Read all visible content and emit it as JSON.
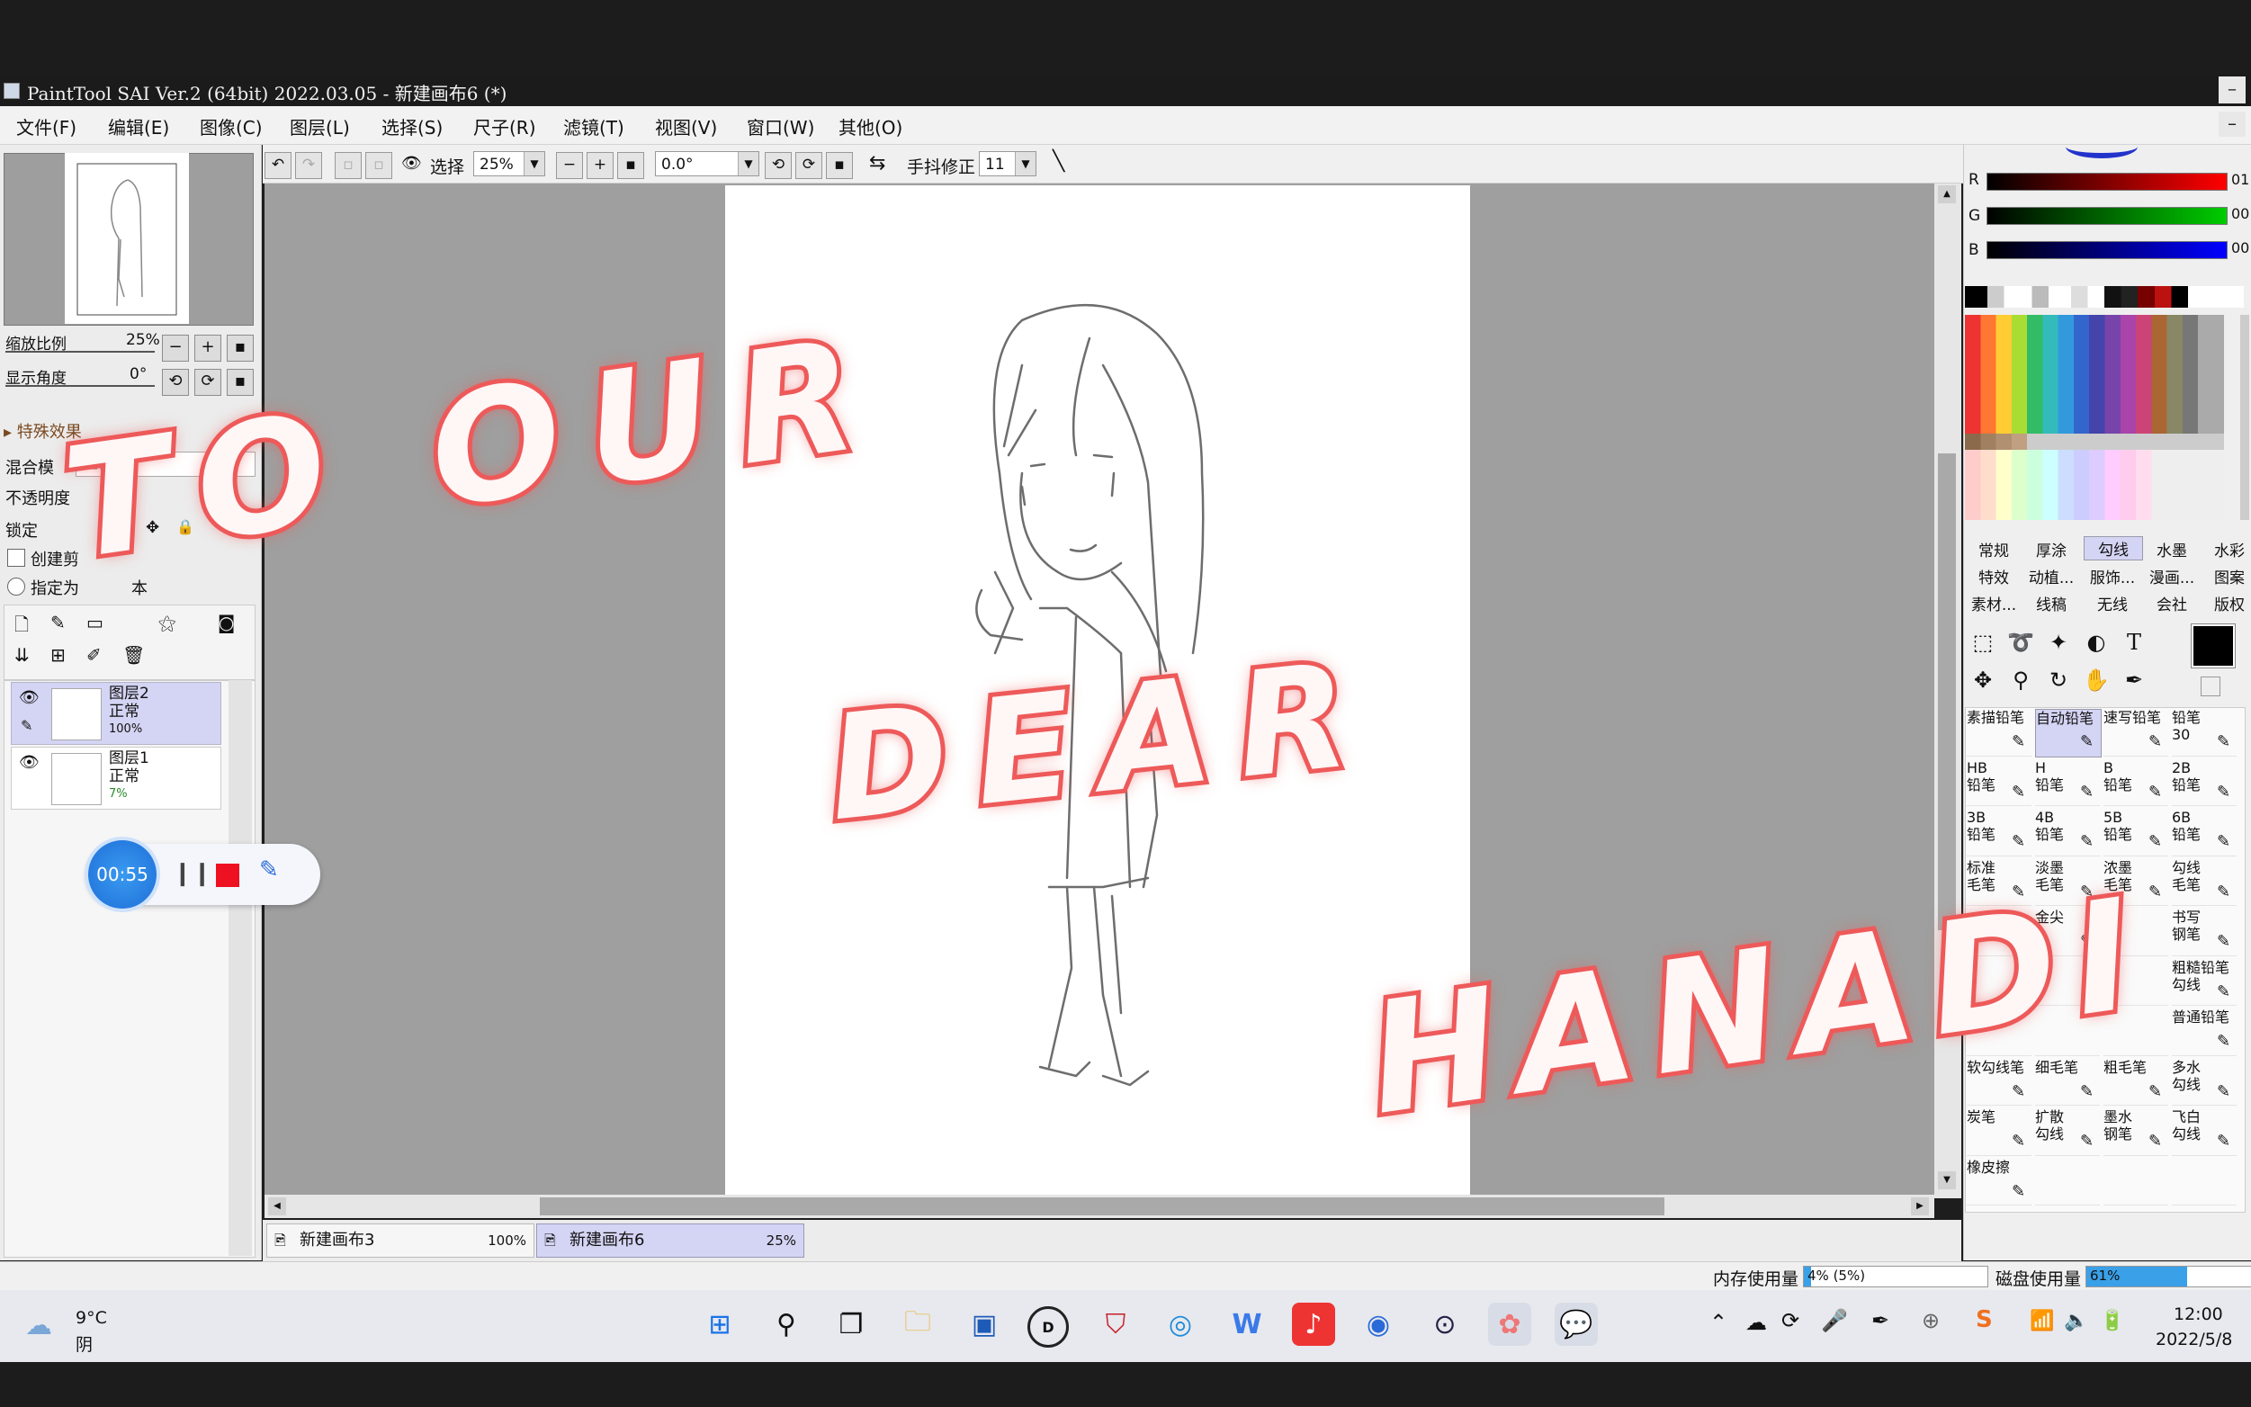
{
  "window": {
    "title": "PaintTool SAI Ver.2 (64bit) 2022.03.05 - 新建画布6 (*)"
  },
  "menu": [
    "文件(F)",
    "编辑(E)",
    "图像(C)",
    "图层(L)",
    "选择(S)",
    "尺子(R)",
    "滤镜(T)",
    "视图(V)",
    "窗口(W)",
    "其他(O)"
  ],
  "navigator": {
    "zoom_label": "缩放比例",
    "zoom_value": "25%",
    "angle_label": "显示角度",
    "angle_value": "0°"
  },
  "layer_props": {
    "effects": "特殊效果",
    "blend": "混合模",
    "blend_value": "正常",
    "opacity": "不透明度",
    "opacity_value": "1",
    "lock": "锁定",
    "clip": "创建剪",
    "designate": "指定为",
    "designate_suffix": "本"
  },
  "layers": [
    {
      "name": "图层2",
      "mode": "正常",
      "opacity": "100%"
    },
    {
      "name": "图层1",
      "mode": "正常",
      "opacity": "7%"
    }
  ],
  "recorder": {
    "time": "00:55"
  },
  "toolbar": {
    "select_label": "选择",
    "zoom": "25%",
    "angle": "0.0°",
    "stabilizer_label": "手抖修正",
    "stabilizer_value": "11"
  },
  "doc_tabs": [
    {
      "name": "新建画布3",
      "zoom": "100%"
    },
    {
      "name": "新建画布6",
      "zoom": "25%"
    }
  ],
  "rgb": [
    {
      "label": "R",
      "value": "01"
    },
    {
      "label": "G",
      "value": "00"
    },
    {
      "label": "B",
      "value": "00"
    }
  ],
  "brush_tabs": [
    [
      "常规",
      "厚涂",
      "勾线",
      "水墨",
      "水彩"
    ],
    [
      "特效",
      "动植...",
      "服饰...",
      "漫画...",
      "图案"
    ],
    [
      "素材...",
      "线稿",
      "无线",
      "会社",
      "版权"
    ]
  ],
  "brush_tools": [
    [
      "素描铅笔",
      "自动铅笔",
      "速写铅笔",
      "铅笔\n30"
    ],
    [
      "HB\n铅笔",
      "H\n铅笔",
      "B\n铅笔",
      "2B\n铅笔"
    ],
    [
      "3B\n铅笔",
      "4B\n铅笔",
      "5B\n铅笔",
      "6B\n铅笔"
    ],
    [
      "标准\n毛笔",
      "淡墨\n毛笔",
      "浓墨\n毛笔",
      "勾线\n毛笔"
    ],
    [
      "",
      "金尖",
      "",
      "书写\n钢笔"
    ],
    [
      "",
      "",
      "",
      "粗糙铅笔\n勾线"
    ],
    [
      "",
      "",
      "",
      "普通铅笔"
    ],
    [
      "软勾线笔",
      "细毛笔",
      "粗毛笔",
      "多水\n勾线"
    ],
    [
      "炭笔",
      "扩散\n勾线",
      "墨水\n钢笔",
      "飞白\n勾线"
    ],
    [
      "橡皮擦",
      "",
      "",
      ""
    ]
  ],
  "status": {
    "mem_label": "内存使用量",
    "mem_value": "4% (5%)",
    "disk_label": "磁盘使用量",
    "disk_value": "61%"
  },
  "taskbar": {
    "weather_temp": "9°C",
    "weather_desc": "阴",
    "time": "12:00",
    "date": "2022/5/8"
  },
  "overlay": {
    "line1": "TO OUR",
    "line2": "DEAR",
    "line3": "HANADI"
  },
  "colors": {
    "accent": "#ee5a5a",
    "selection": "#d4d4f4",
    "canvas_bg": "#9f9f9f"
  }
}
